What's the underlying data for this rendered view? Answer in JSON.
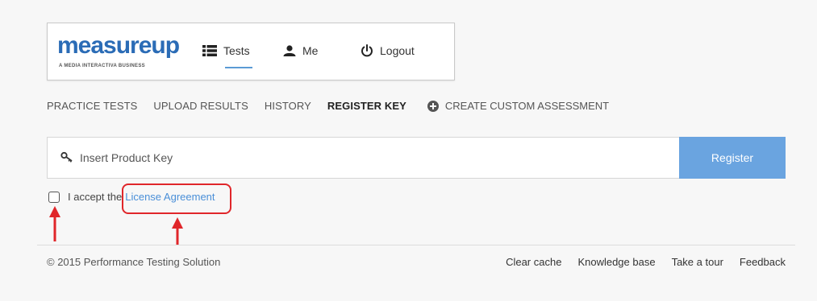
{
  "logo": {
    "word": "measureup",
    "tagline": "A MEDIA INTERACTIVA BUSINESS"
  },
  "nav": {
    "tests": "Tests",
    "me": "Me",
    "logout": "Logout"
  },
  "subnav": {
    "practice_tests": "PRACTICE TESTS",
    "upload_results": "UPLOAD RESULTS",
    "history": "HISTORY",
    "register_key": "REGISTER KEY",
    "create_custom": "CREATE CUSTOM ASSESSMENT"
  },
  "register": {
    "placeholder": "Insert Product Key",
    "button": "Register"
  },
  "accept": {
    "prefix": "I accept the",
    "link": "License Agreement"
  },
  "footer": {
    "copyright": "© 2015 Performance Testing Solution",
    "links": [
      "Clear cache",
      "Knowledge base",
      "Take a tour",
      "Feedback"
    ]
  },
  "colors": {
    "brand_blue": "#2b6cb6",
    "button_blue": "#6aa4e0",
    "link_blue": "#4a8fd8",
    "annotation_red": "#e0262a"
  },
  "icons": [
    "list-icon",
    "user-icon",
    "power-icon",
    "plus-circle-icon",
    "key-icon",
    "arrow-up-icon"
  ]
}
